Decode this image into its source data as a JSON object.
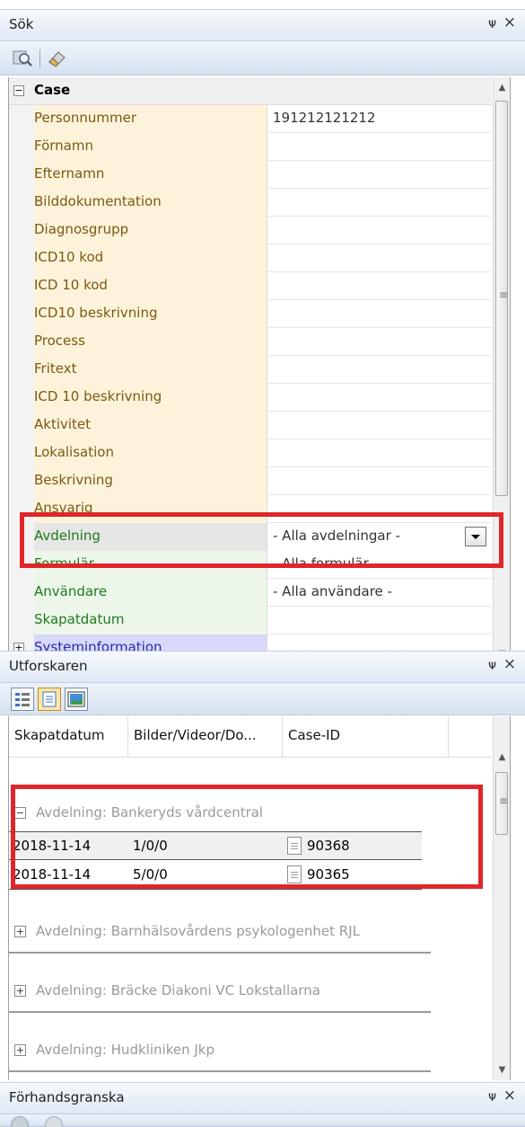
{
  "search_panel": {
    "title": "Sök",
    "pin": "ᵖ",
    "close": "×",
    "category": "Case",
    "fields": [
      {
        "label": "Personnummer",
        "value": "191212121212",
        "style": "case"
      },
      {
        "label": "Förnamn",
        "value": "",
        "style": "case"
      },
      {
        "label": "Efternamn",
        "value": "",
        "style": "case"
      },
      {
        "label": "Bilddokumentation",
        "value": "",
        "style": "case"
      },
      {
        "label": "Diagnosgrupp",
        "value": "",
        "style": "case"
      },
      {
        "label": "ICD10 kod",
        "value": "",
        "style": "case"
      },
      {
        "label": "ICD 10 kod",
        "value": "",
        "style": "case"
      },
      {
        "label": "ICD10 beskrivning",
        "value": "",
        "style": "case"
      },
      {
        "label": "Process",
        "value": "",
        "style": "case"
      },
      {
        "label": "Fritext",
        "value": "",
        "style": "case"
      },
      {
        "label": "ICD 10 beskrivning",
        "value": "",
        "style": "case"
      },
      {
        "label": "Aktivitet",
        "value": "",
        "style": "case"
      },
      {
        "label": "Lokalisation",
        "value": "",
        "style": "case"
      },
      {
        "label": "Beskrivning",
        "value": "",
        "style": "case"
      },
      {
        "label": "Ansvarig",
        "value": "",
        "style": "case"
      },
      {
        "label": "Avdelning",
        "value": "- Alla avdelningar -",
        "style": "green"
      },
      {
        "label": "Formulär",
        "value": "- Alla formulär -",
        "style": "green"
      },
      {
        "label": "Användare",
        "value": "- Alla användare -",
        "style": "green"
      },
      {
        "label": "Skapatdatum",
        "value": "",
        "style": "green"
      },
      {
        "label": "Systeminformation",
        "value": "",
        "style": "purple"
      }
    ]
  },
  "explorer_panel": {
    "title": "Utforskaren",
    "columns": [
      "Skapatdatum",
      "Bilder/Videor/Do...",
      "Case-ID"
    ],
    "groups": [
      {
        "label": "Avdelning: Bankeryds vårdcentral",
        "expanded": true,
        "rows": [
          {
            "date": "2018-11-14",
            "media": "1/0/0",
            "case_id": "90368"
          },
          {
            "date": "2018-11-14",
            "media": "5/0/0",
            "case_id": "90365"
          }
        ]
      },
      {
        "label": "Avdelning: Barnhälsovårdens psykologenhet RJL",
        "expanded": false
      },
      {
        "label": "Avdelning: Bräcke Diakoni VC Lokstallarna",
        "expanded": false
      },
      {
        "label": "Avdelning: Hudkliniken Jkp",
        "expanded": false
      }
    ]
  },
  "preview_panel": {
    "title": "Förhandsgranska"
  },
  "colors": {
    "highlight": "#e0262a",
    "case_label_bg": "#fdf3da",
    "green_label_bg": "#ecf7ea",
    "purple_label_bg": "#d7d8fa"
  }
}
